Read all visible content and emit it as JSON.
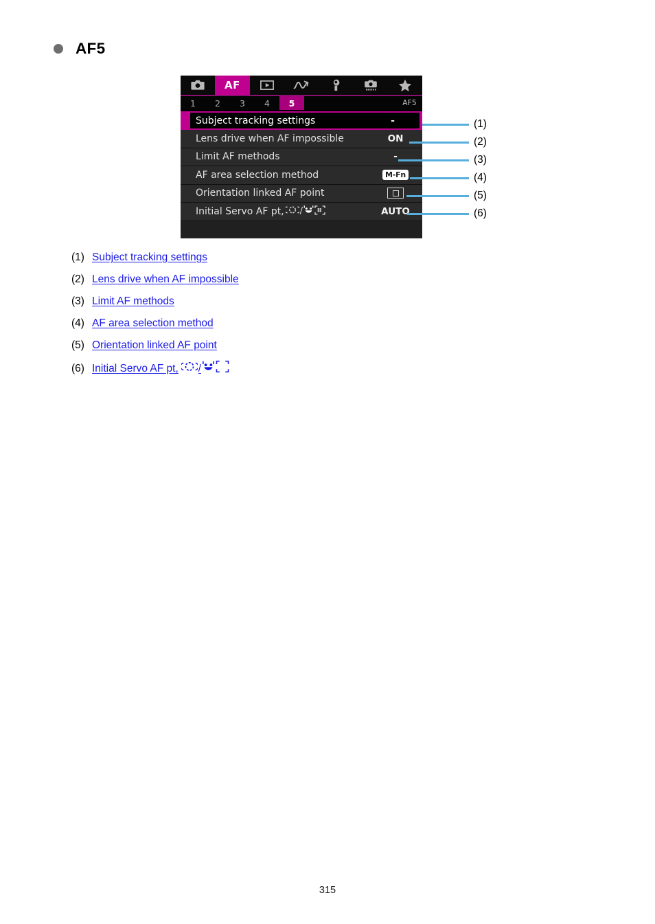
{
  "heading": {
    "bullet": "bullet-dot",
    "title": "AF5"
  },
  "camera_menu": {
    "icon_tabs": [
      {
        "name": "shooting-tab",
        "icon": "camera-icon",
        "label": "",
        "active": false
      },
      {
        "name": "af-tab",
        "icon": "af-text-icon",
        "label": "AF",
        "active": true
      },
      {
        "name": "playback-tab",
        "icon": "playback-icon",
        "label": "",
        "active": false
      },
      {
        "name": "network-tab",
        "icon": "wireless-icon",
        "label": "",
        "active": false
      },
      {
        "name": "setup-tab",
        "icon": "wrench-icon",
        "label": "",
        "active": false
      },
      {
        "name": "custom-functions-tab",
        "icon": "custom-camera-icon",
        "label": "",
        "active": false
      },
      {
        "name": "my-menu-tab",
        "icon": "star-icon",
        "label": "",
        "active": false
      }
    ],
    "number_tabs": [
      {
        "label": "1",
        "active": false
      },
      {
        "label": "2",
        "active": false
      },
      {
        "label": "3",
        "active": false
      },
      {
        "label": "4",
        "active": false
      },
      {
        "label": "5",
        "active": true
      }
    ],
    "page_code": "AF5",
    "rows": [
      {
        "label": "Subject tracking settings",
        "value": "-",
        "selected": true
      },
      {
        "label": "Lens drive when AF impossible",
        "value": "ON",
        "selected": false
      },
      {
        "label": "Limit AF methods",
        "value": "-",
        "selected": false
      },
      {
        "label": "AF area selection method",
        "value": "M-Fn",
        "selected": false
      },
      {
        "label": "Orientation linked AF point",
        "value": "",
        "selected": false
      },
      {
        "label": "Initial Servo AF pt,",
        "value": "AUTO",
        "selected": false
      }
    ]
  },
  "callouts": [
    {
      "number": "(1)"
    },
    {
      "number": "(2)"
    },
    {
      "number": "(3)"
    },
    {
      "number": "(4)"
    },
    {
      "number": "(5)"
    },
    {
      "number": "(6)"
    }
  ],
  "link_list": [
    {
      "number": "(1)",
      "text": "Subject tracking settings",
      "has_icons": false
    },
    {
      "number": "(2)",
      "text": "Lens drive when AF impossible",
      "has_icons": false
    },
    {
      "number": "(3)",
      "text": "Limit AF methods",
      "has_icons": false
    },
    {
      "number": "(4)",
      "text": "AF area selection method",
      "has_icons": false
    },
    {
      "number": "(5)",
      "text": "Orientation linked AF point",
      "has_icons": false
    },
    {
      "number": "(6)",
      "text": "Initial Servo AF pt,",
      "has_icons": true
    }
  ],
  "footer": {
    "page_number": "315"
  },
  "colors": {
    "accent_magenta": "#c0008f",
    "callout_blue": "#58aedc",
    "link_blue": "#1a1ae6",
    "menu_bg": "#000000",
    "row_bg": "#2b2b2b"
  }
}
